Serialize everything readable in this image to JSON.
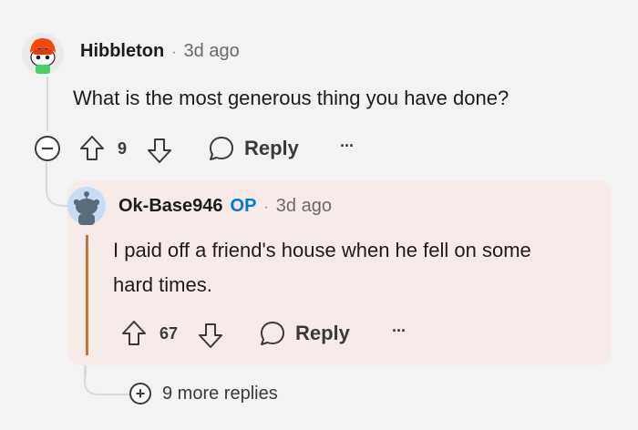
{
  "comment": {
    "author": "Hibbleton",
    "separator": "·",
    "time": "3d ago",
    "text": "What is the most generous thing you have done?",
    "votes": "9",
    "reply_label": "Reply",
    "more_label": "···"
  },
  "reply": {
    "author": "Ok-Base946",
    "op_badge": "OP",
    "separator": "·",
    "time": "3d ago",
    "text_line1": "I paid off a friend's house when he fell on some",
    "text_line2": "hard times.",
    "votes": "67",
    "reply_label": "Reply",
    "more_label": "···"
  },
  "more_replies": {
    "label": "9 more replies",
    "expand_symbol": "+"
  },
  "colors": {
    "op_badge": "#0079d3",
    "op_bar": "#c7743a",
    "reply_background": "#f7ebe9"
  }
}
